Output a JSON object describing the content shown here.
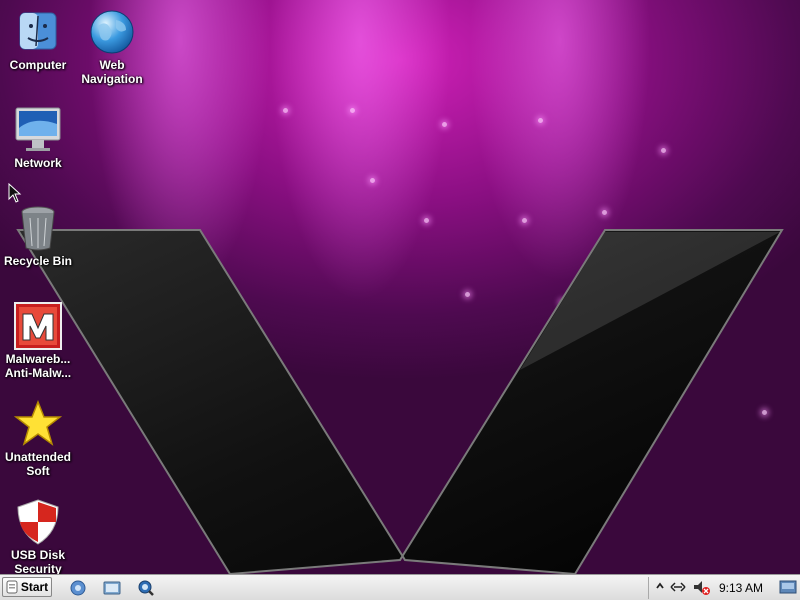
{
  "desktop": {
    "icons": [
      {
        "label": "Computer",
        "icon": "finder-icon"
      },
      {
        "label": "Web\nNavigation",
        "icon": "globe-icon"
      },
      {
        "label": "Network",
        "icon": "monitor-icon"
      },
      {
        "label": "Recycle Bin",
        "icon": "trash-icon"
      },
      {
        "label": "Malwareb...\nAnti-Malw...",
        "icon": "malwarebytes-icon"
      },
      {
        "label": "Unattended\nSoft",
        "icon": "star-icon"
      },
      {
        "label": "USB Disk\nSecurity",
        "icon": "shield-icon"
      }
    ]
  },
  "taskbar": {
    "start_label": "Start",
    "quick_launch": [
      "browser-icon",
      "file-manager-icon",
      "search-icon"
    ],
    "tray": {
      "icons": [
        "show-hidden-icons-icon",
        "network-icon",
        "volume-muted-icon",
        "show-desktop-icon"
      ],
      "clock": "9:13 AM"
    }
  },
  "colors": {
    "background_magenta": "#d020b8",
    "background_dark": "#3a083c",
    "taskbar": "#e6e6e6"
  }
}
